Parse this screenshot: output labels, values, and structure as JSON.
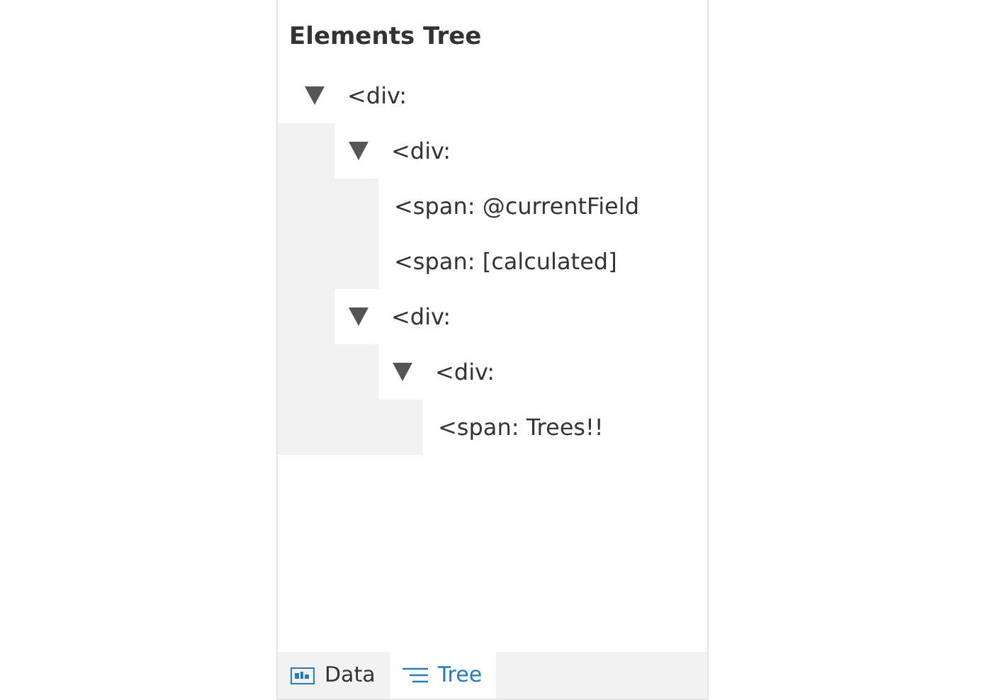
{
  "panel": {
    "title": "Elements Tree"
  },
  "tree": [
    {
      "label": "<div:",
      "expanded": true,
      "children": [
        {
          "label": "<div:",
          "expanded": true,
          "children": [
            {
              "label": "<span: @currentField"
            },
            {
              "label": "<span: [calculated]"
            }
          ]
        },
        {
          "label": "<div:",
          "expanded": true,
          "children": [
            {
              "label": "<div:",
              "expanded": true,
              "children": [
                {
                  "label": "<span: Trees!!"
                }
              ]
            }
          ]
        }
      ]
    }
  ],
  "tabs": [
    {
      "label": "Data",
      "kind": "data",
      "selected": false
    },
    {
      "label": "Tree",
      "kind": "tree",
      "selected": true
    }
  ]
}
